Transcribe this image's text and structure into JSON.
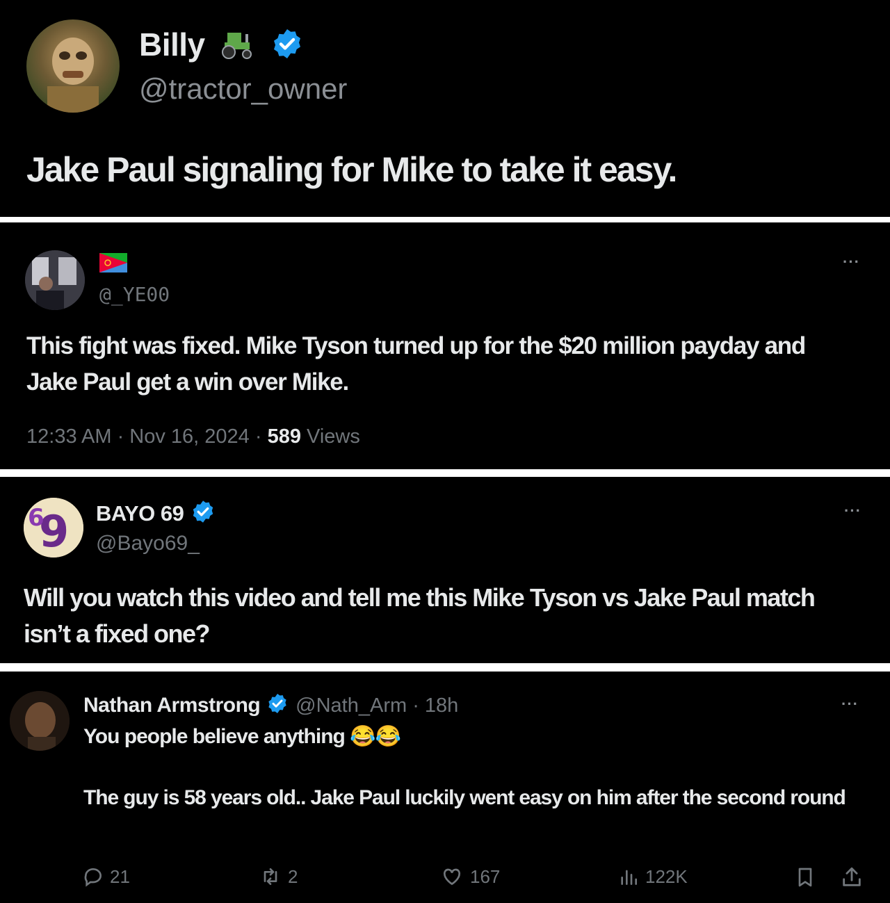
{
  "tweet1": {
    "name": "Billy",
    "name_emoji": "tractor-emoji",
    "handle": "@tractor_owner",
    "text": "Jake Paul signaling for Mike to take it easy."
  },
  "tweet2": {
    "flag": "eritrea-flag",
    "handle": "@_YE00",
    "text": "This fight was fixed. Mike Tyson turned up for the $20 million payday and Jake Paul get a win over Mike.",
    "time": "12:33 AM · Nov 16, 2024 · ",
    "views_count": "589",
    "views_label": " Views",
    "more": "···"
  },
  "tweet3": {
    "name": "BAYO 69",
    "handle": "@Bayo69_",
    "text": "Will you watch this video and tell me this Mike Tyson vs Jake Paul match isn’t a fixed one?",
    "more": "···"
  },
  "tweet4": {
    "name": "Nathan Armstrong",
    "handle_time": "@Nath_Arm · 18h",
    "line1": "You people believe anything 😂😂",
    "line2": "The guy is 58 years old.. Jake Paul luckily went easy on him after the second round",
    "more": "···",
    "actions": {
      "replies": "21",
      "reposts": "2",
      "likes": "167",
      "views": "122K"
    }
  },
  "colors": {
    "background": "#000000",
    "divider": "#ffffff",
    "verified": "#1d9bf0",
    "muted_text": "#71767b",
    "primary_text": "#e7e9ea"
  }
}
